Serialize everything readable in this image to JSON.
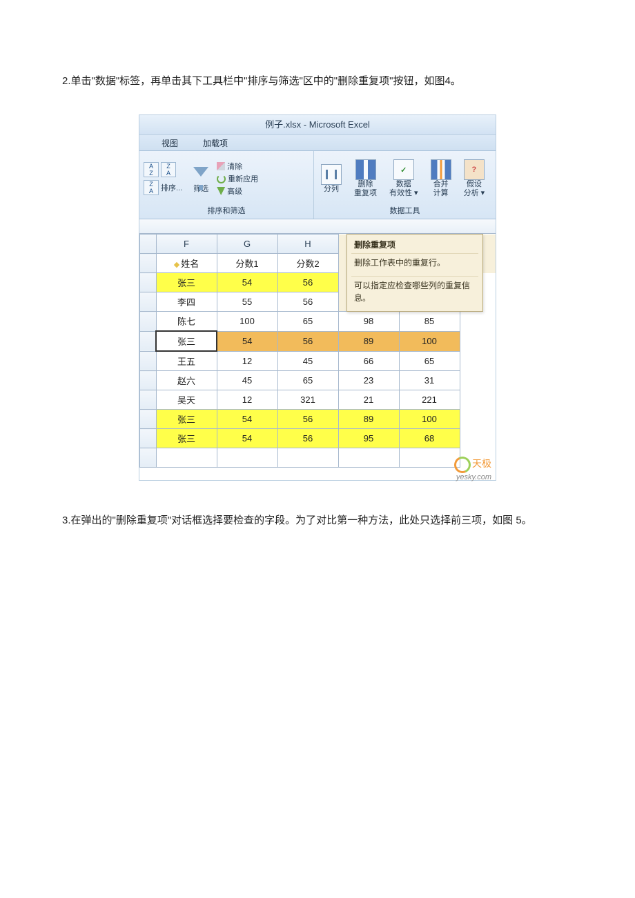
{
  "doc": {
    "para1": "2.单击\"数据\"标签，再单击其下工具栏中\"排序与筛选\"区中的\"删除重复项\"按钮，如图4。",
    "para2": "3.在弹出的\"删除重复项\"对话框选择要检查的字段。为了对比第一种方法，此处只选择前三项，如图 5。"
  },
  "app": {
    "title": "例子.xlsx - Microsoft Excel",
    "tabs": {
      "view": "视图",
      "addins": "加载项"
    },
    "ribbon": {
      "sort_group": "排序和筛选",
      "tools_group": "数据工具",
      "sort": "排序...",
      "filter": "筛选",
      "clear": "清除",
      "reapply": "重新应用",
      "advanced": "高级",
      "text_to_cols": "分列",
      "remove_dup": "删除",
      "remove_dup2": "重复项",
      "data_val": "数据",
      "data_val2": "有效性 ▾",
      "consolidate": "合并",
      "consolidate2": "计算",
      "whatif": "假设",
      "whatif2": "分析 ▾"
    },
    "tooltip": {
      "title": "删除重复项",
      "line1": "删除工作表中的重复行。",
      "line2": "可以指定应检查哪些列的重复信息。"
    },
    "cols": {
      "F": "F",
      "G": "G",
      "H": "H"
    },
    "headers": {
      "name": "姓名",
      "s1": "分数1",
      "s2": "分数2"
    },
    "rows": [
      {
        "name": "张三",
        "f": "54",
        "g": "56",
        "h": "",
        "i": "",
        "cls": "hl"
      },
      {
        "name": "李四",
        "f": "55",
        "g": "56",
        "h": "",
        "i": "",
        "cls": ""
      },
      {
        "name": "陈七",
        "f": "100",
        "g": "65",
        "h": "98",
        "i": "85",
        "cls": ""
      },
      {
        "name": "张三",
        "f": "54",
        "g": "56",
        "h": "89",
        "i": "100",
        "cls": "sel"
      },
      {
        "name": "王五",
        "f": "12",
        "g": "45",
        "h": "66",
        "i": "65",
        "cls": ""
      },
      {
        "name": "赵六",
        "f": "45",
        "g": "65",
        "h": "23",
        "i": "31",
        "cls": ""
      },
      {
        "name": "吴天",
        "f": "12",
        "g": "321",
        "h": "21",
        "i": "221",
        "cls": ""
      },
      {
        "name": "张三",
        "f": "54",
        "g": "56",
        "h": "89",
        "i": "100",
        "cls": "hl"
      },
      {
        "name": "张三",
        "f": "54",
        "g": "56",
        "h": "95",
        "i": "68",
        "cls": "hl"
      }
    ],
    "watermark": {
      "brand": "天极",
      "url": "yesky.com"
    }
  }
}
